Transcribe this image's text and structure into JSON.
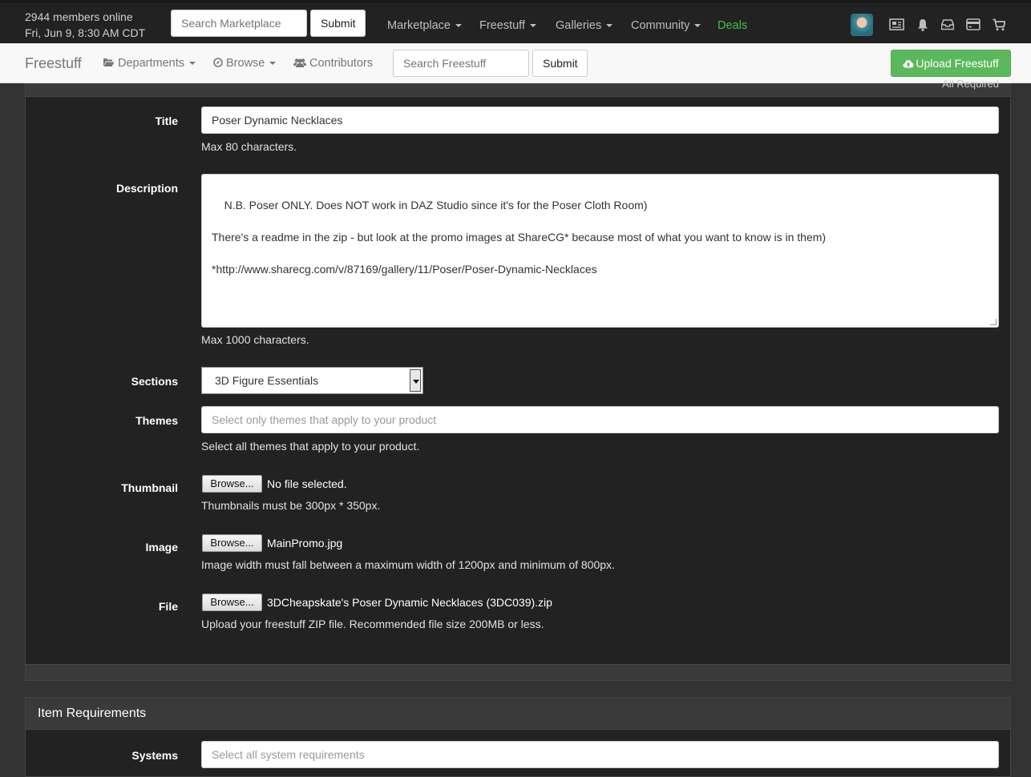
{
  "topbar": {
    "members_online": "2944 members online",
    "datetime": "Fri, Jun 9, 8:30 AM CDT",
    "search_placeholder": "Search Marketplace",
    "submit_label": "Submit",
    "nav": {
      "marketplace": "Marketplace",
      "freestuff": "Freestuff",
      "galleries": "Galleries",
      "community": "Community",
      "deals": "Deals"
    },
    "icons": [
      "avatar",
      "news-icon",
      "bell-icon",
      "inbox-icon",
      "credit-card-icon",
      "cart-icon"
    ],
    "deals_color": "#3cc43c"
  },
  "subbar": {
    "brand": "Freestuff",
    "departments": "Departments",
    "browse": "Browse",
    "contributors": "Contributors",
    "search_placeholder": "Search Freestuff",
    "submit_label": "Submit",
    "upload_label": "Upload Freestuff",
    "upload_color": "#5cb85c"
  },
  "form": {
    "all_required": "All Required",
    "title": {
      "label": "Title",
      "value": "Poser Dynamic Necklaces",
      "help": "Max 80 characters."
    },
    "description": {
      "label": "Description",
      "value": "N.B. Poser ONLY. Does NOT work in DAZ Studio since it's for the Poser Cloth Room)\n\nThere's a readme in the zip - but look at the promo images at ShareCG* because most of what you want to know is in them)\n\n*http://www.sharecg.com/v/87169/gallery/11/Poser/Poser-Dynamic-Necklaces",
      "help": "Max 1000 characters."
    },
    "sections": {
      "label": "Sections",
      "selected": "3D Figure Essentials"
    },
    "themes": {
      "label": "Themes",
      "placeholder": "Select only themes that apply to your product",
      "help": "Select all themes that apply to your product."
    },
    "thumbnail": {
      "label": "Thumbnail",
      "browse_label": "Browse...",
      "file": "No file selected.",
      "help": "Thumbnails must be 300px * 350px."
    },
    "image": {
      "label": "Image",
      "browse_label": "Browse...",
      "file": "MainPromo.jpg",
      "help": "Image width must fall between a maximum width of 1200px and minimum of 800px."
    },
    "file": {
      "label": "File",
      "browse_label": "Browse...",
      "file": "3DCheapskate's Poser Dynamic Necklaces (3DC039).zip",
      "help": "Upload your freestuff ZIP file. Recommended file size 200MB or less."
    }
  },
  "requirements": {
    "heading": "Item Requirements",
    "systems": {
      "label": "Systems",
      "placeholder": "Select all system requirements"
    }
  }
}
